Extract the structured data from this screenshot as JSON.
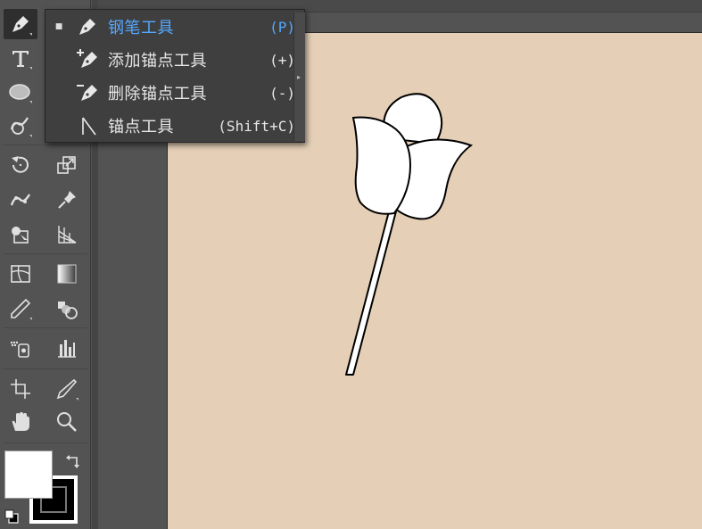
{
  "flyout_menu": {
    "items": [
      {
        "label": "钢笔工具",
        "shortcut": "(P)",
        "selected": true,
        "icon": "pen-icon"
      },
      {
        "label": "添加锚点工具",
        "shortcut": "(+)",
        "selected": false,
        "icon": "add-anchor-point-icon"
      },
      {
        "label": "删除锚点工具",
        "shortcut": "(-)",
        "selected": false,
        "icon": "delete-anchor-point-icon"
      },
      {
        "label": "锚点工具",
        "shortcut": "(Shift+C)",
        "selected": false,
        "icon": "anchor-point-icon"
      }
    ]
  },
  "toolbar": {
    "tools": [
      "pen-icon",
      "type-icon",
      "ellipse-icon",
      "shaper-icon",
      "rotate-icon",
      "scale-icon",
      "puppet-warp-icon",
      "pin-icon",
      "shape-builder-icon",
      "perspective-grid-icon",
      "mesh-icon",
      "gradient-icon",
      "eyedropper-icon",
      "blend-icon",
      "symbol-sprayer-icon",
      "column-graph-icon",
      "artboard-icon",
      "knife-icon",
      "hand-icon",
      "zoom-icon"
    ],
    "fill_color": "#ffffff",
    "stroke_color": "#000000"
  },
  "canvas": {
    "artboard_color": "#e5d0b7",
    "pasteboard_color": "#535353"
  },
  "colors": {
    "accent": "#54a7ff",
    "menu_text": "#e6e6e6",
    "menu_bg": "#3f3f3f"
  }
}
